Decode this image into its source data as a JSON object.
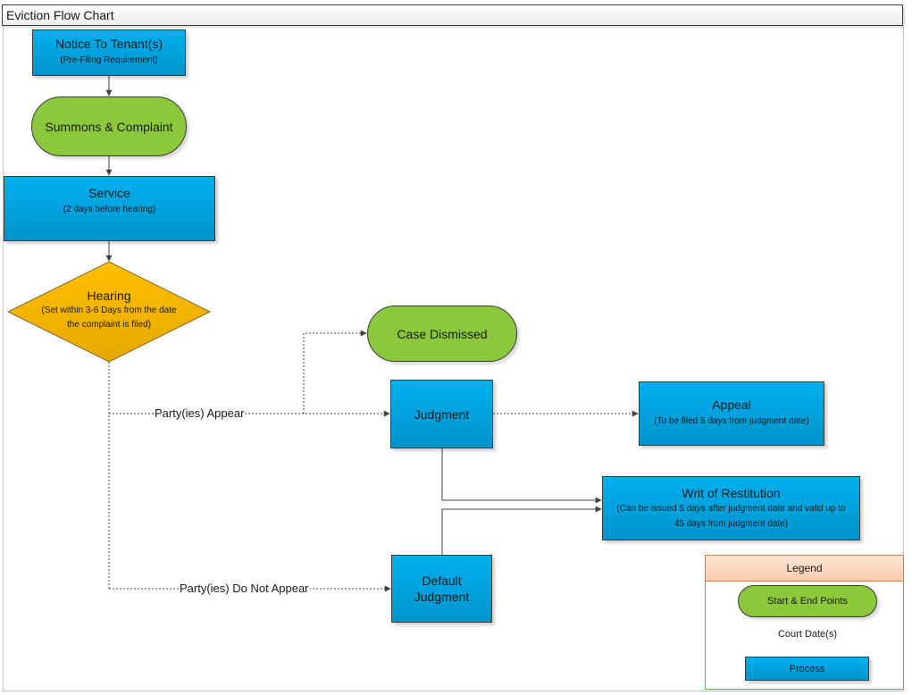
{
  "title": "Eviction Flow Chart",
  "nodes": {
    "notice": {
      "title": "Notice To Tenant(s)",
      "subtitle": "(Pre-Filing Requirement)",
      "shape": "process"
    },
    "summons": {
      "title": "Summons & Complaint",
      "shape": "terminal"
    },
    "service": {
      "title": "Service",
      "subtitle": "(2 days before hearing)",
      "shape": "process"
    },
    "hearing": {
      "title": "Hearing",
      "subtitle_line1": "(Set within 3-6 Days from the date",
      "subtitle_line2": "the complaint is filed)",
      "shape": "decision"
    },
    "case_dismissed": {
      "title": "Case Dismissed",
      "shape": "terminal"
    },
    "judgment": {
      "title": "Judgment",
      "shape": "process"
    },
    "appeal": {
      "title": "Appeal",
      "subtitle": "(To be filed 5 days from judgment date)",
      "shape": "process"
    },
    "writ": {
      "title": "Writ of Restitution",
      "subtitle_line1": "(Can be issued 5 days after judgment date and valid up to",
      "subtitle_line2": "45 days from judgment date)",
      "shape": "process"
    },
    "default_judgment": {
      "title_line1": "Default",
      "title_line2": "Judgment",
      "shape": "process"
    }
  },
  "edges": {
    "appear_label": "Party(ies) Appear",
    "not_appear_label": "Party(ies) Do Not Appear"
  },
  "legend": {
    "title": "Legend",
    "items": [
      {
        "label": "Start & End Points",
        "shape": "terminal"
      },
      {
        "label": "Court Date(s)",
        "shape": "decision"
      },
      {
        "label": "Process",
        "shape": "process"
      }
    ]
  },
  "colors": {
    "process": "#00a9e6",
    "terminal": "#8cc83c",
    "decision": "#f5b400",
    "legend_border": "#e07b39",
    "legend_header": "#fbe5d6"
  }
}
